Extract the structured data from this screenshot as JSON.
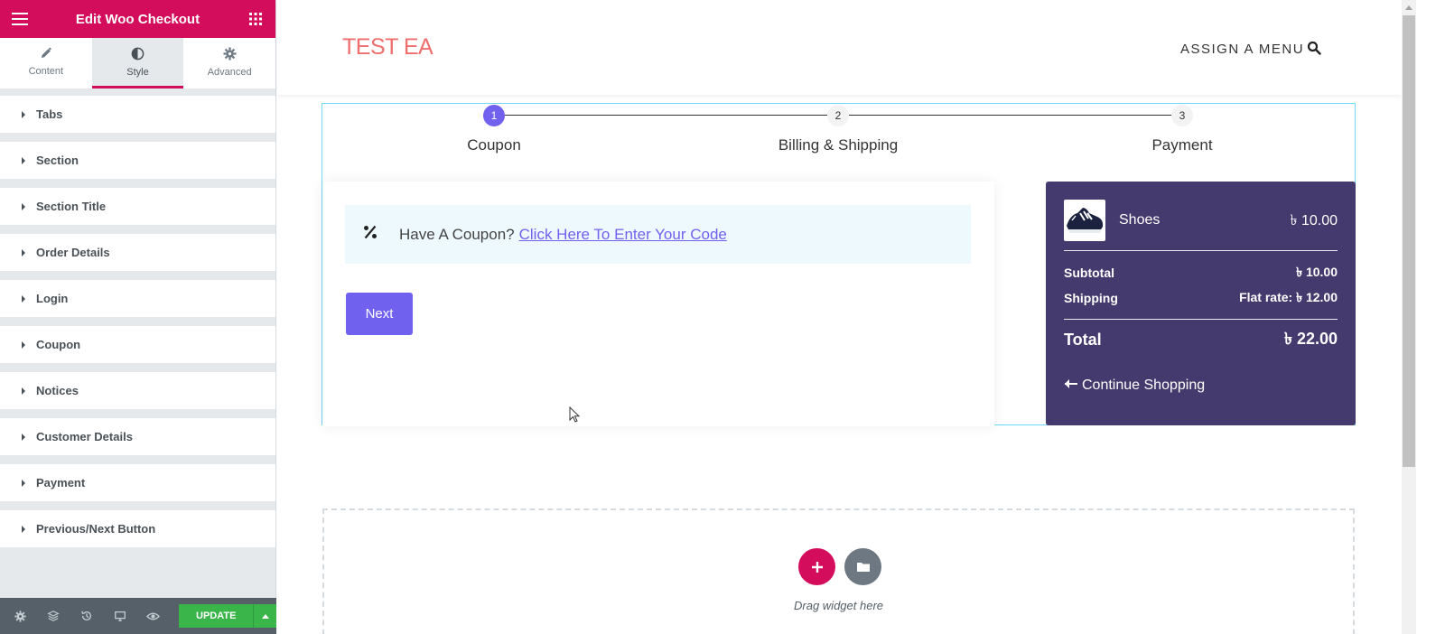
{
  "panel": {
    "title": "Edit Woo Checkout",
    "tabs": [
      {
        "label": "Content",
        "icon": "pencil-icon"
      },
      {
        "label": "Style",
        "icon": "half-circle-icon"
      },
      {
        "label": "Advanced",
        "icon": "gear-icon"
      }
    ],
    "active_tab": "Style",
    "sections": [
      "Tabs",
      "Section",
      "Section Title",
      "Order Details",
      "Login",
      "Coupon",
      "Notices",
      "Customer Details",
      "Payment",
      "Previous/Next Button"
    ],
    "footer": {
      "update_label": "UPDATE"
    },
    "accent_color": "#d30c5c"
  },
  "site": {
    "title": "TEST EA",
    "menu_label": "ASSIGN A MENU"
  },
  "checkout": {
    "steps": [
      {
        "number": "1",
        "label": "Coupon"
      },
      {
        "number": "2",
        "label": "Billing & Shipping"
      },
      {
        "number": "3",
        "label": "Payment"
      }
    ],
    "coupon_prompt": "Have A Coupon?",
    "coupon_link": "Click Here To Enter Your Code",
    "next_label": "Next",
    "accent_color": "#7161ef"
  },
  "order": {
    "product_name": "Shoes",
    "product_price": "৳ 10.00",
    "subtotal_label": "Subtotal",
    "subtotal_value": "৳ 10.00",
    "shipping_label": "Shipping",
    "shipping_value": "Flat rate: ৳ 12.00",
    "total_label": "Total",
    "total_value": "৳ 22.00",
    "continue_label": "Continue Shopping",
    "bg_color": "#443a6e"
  },
  "dropzone": {
    "text": "Drag widget here"
  }
}
